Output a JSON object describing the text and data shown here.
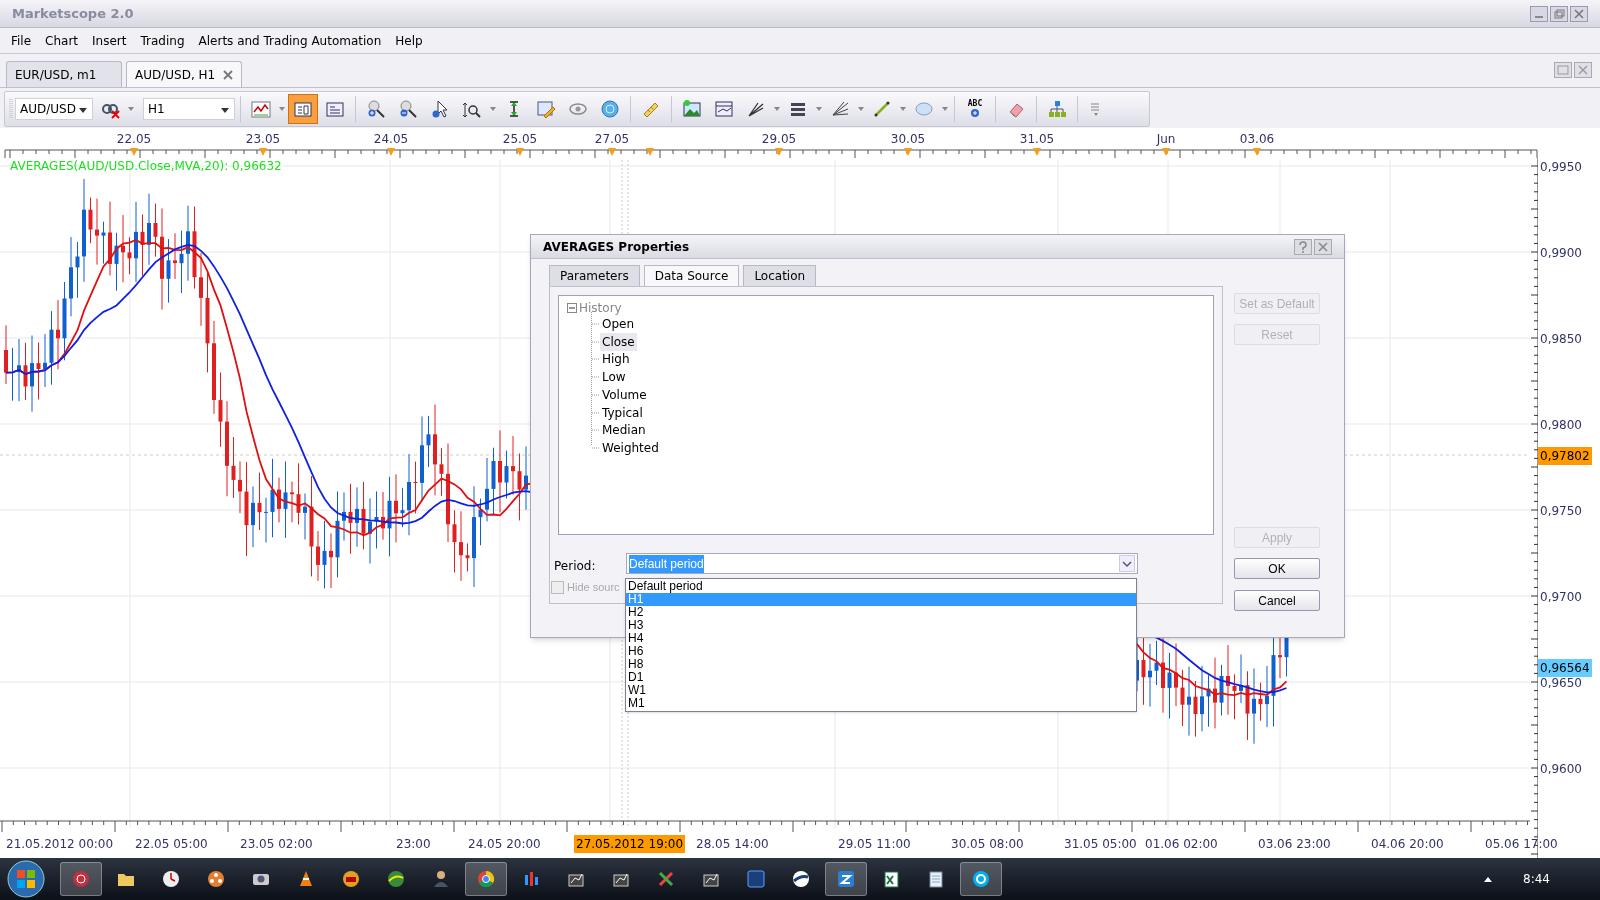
{
  "window": {
    "title": "Marketscope 2.0"
  },
  "menu": [
    "File",
    "Chart",
    "Insert",
    "Trading",
    "Alerts and Trading Automation",
    "Help"
  ],
  "chart_tabs": [
    {
      "label": "EUR/USD, m1",
      "selected": false
    },
    {
      "label": "AUD/USD, H1",
      "selected": true
    }
  ],
  "toolbar": {
    "symbol": "AUD/USD",
    "timeframe": "H1",
    "tools": [
      {
        "pressed": false
      },
      {
        "pressed": false
      },
      {
        "pressed": true
      },
      {
        "pressed": false
      },
      {
        "pressed": false
      },
      {
        "pressed": false
      },
      {
        "pressed": false
      },
      {
        "pressed": false
      },
      {
        "pressed": false
      },
      {
        "pressed": false
      },
      {
        "pressed": false
      },
      {
        "pressed": false
      },
      {
        "pressed": false
      },
      {
        "pressed": false
      },
      {
        "pressed": false
      },
      {
        "pressed": false
      },
      {
        "pressed": false
      },
      {
        "pressed": false
      },
      {
        "pressed": false
      },
      {
        "pressed": false
      },
      {
        "pressed": false,
        "label": "ABC"
      },
      {
        "pressed": false
      },
      {
        "pressed": false
      },
      {
        "pressed": false
      }
    ]
  },
  "chart": {
    "indicator_label": "AVERAGES(AUD/USD.Close,MVA,20): 0,96632",
    "top_dates": [
      "22.05",
      "23.05",
      "24.05",
      "25.05",
      "27.05",
      "29.05",
      "30.05",
      "31.05",
      "Jun",
      "03.06"
    ],
    "price_labels": [
      "0,9950",
      "0,9900",
      "0,9850",
      "0,9800",
      "0,9750",
      "0,9700",
      "0,9650",
      "0,9600"
    ],
    "price_markers": [
      {
        "text": "0,97802",
        "color": "#ff9900"
      },
      {
        "text": "0,96564",
        "color": "#66ccff"
      }
    ],
    "time_labels": [
      {
        "text": "21.05.2012 00:00",
        "selected": false
      },
      {
        "text": "22.05 05:00",
        "selected": false
      },
      {
        "text": "23.05 02:00",
        "selected": false
      },
      {
        "text": "23:00",
        "selected": false
      },
      {
        "text": "24.05 20:00",
        "selected": false
      },
      {
        "text": "27.05.2012 19:00",
        "selected": true
      },
      {
        "text": "28.05 14:00",
        "selected": false
      },
      {
        "text": "29.05 11:00",
        "selected": false
      },
      {
        "text": "30.05 08:00",
        "selected": false
      },
      {
        "text": "31.05 05:00",
        "selected": false
      },
      {
        "text": "01.06 02:00",
        "selected": false
      },
      {
        "text": "03.06 23:00",
        "selected": false
      },
      {
        "text": "04.06 20:00",
        "selected": false
      },
      {
        "text": "05.06 17:00",
        "selected": false
      }
    ]
  },
  "dialog": {
    "title": "AVERAGES Properties",
    "tabs": [
      {
        "label": "Parameters",
        "selected": false
      },
      {
        "label": "Data Source",
        "selected": true
      },
      {
        "label": "Location",
        "selected": false
      }
    ],
    "tree": {
      "label": "History",
      "expanded": true,
      "children": [
        {
          "label": "Open",
          "selected": false
        },
        {
          "label": "Close",
          "selected": true
        },
        {
          "label": "High",
          "selected": false
        },
        {
          "label": "Low",
          "selected": false
        },
        {
          "label": "Volume",
          "selected": false
        },
        {
          "label": "Typical",
          "selected": false
        },
        {
          "label": "Median",
          "selected": false
        },
        {
          "label": "Weighted",
          "selected": false
        }
      ]
    },
    "period_label": "Period:",
    "period_value": "Default period",
    "period_options": [
      {
        "label": "Default period",
        "selected": false
      },
      {
        "label": "H1",
        "selected": true
      },
      {
        "label": "H2",
        "selected": false
      },
      {
        "label": "H3",
        "selected": false
      },
      {
        "label": "H4",
        "selected": false
      },
      {
        "label": "H6",
        "selected": false
      },
      {
        "label": "H8",
        "selected": false
      },
      {
        "label": "D1",
        "selected": false
      },
      {
        "label": "W1",
        "selected": false
      },
      {
        "label": "M1",
        "selected": false
      }
    ],
    "hide_source": {
      "label": "Hide sourc",
      "checked": false,
      "disabled": true
    },
    "buttons": [
      {
        "label": "Set as Default",
        "disabled": true
      },
      {
        "label": "Reset",
        "disabled": true
      },
      {
        "label": "Apply",
        "disabled": true
      },
      {
        "label": "OK",
        "disabled": false
      },
      {
        "label": "Cancel",
        "disabled": false
      }
    ]
  },
  "taskbar": {
    "apps": [
      {
        "active": true
      },
      {
        "active": false
      },
      {
        "active": false
      },
      {
        "active": false
      },
      {
        "active": false
      },
      {
        "active": false
      },
      {
        "active": false
      },
      {
        "active": false
      },
      {
        "active": false
      },
      {
        "active": true
      },
      {
        "active": false
      },
      {
        "active": false
      },
      {
        "active": false
      },
      {
        "active": false
      },
      {
        "active": false
      },
      {
        "active": false
      },
      {
        "active": false
      },
      {
        "active": true
      },
      {
        "active": false
      },
      {
        "active": false
      },
      {
        "active": true
      }
    ],
    "clock": "8:44"
  }
}
